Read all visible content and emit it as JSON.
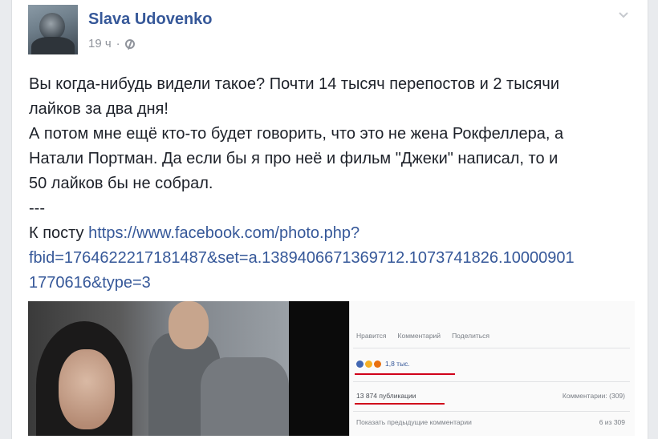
{
  "post": {
    "author": "Slava Udovenko",
    "time": "19 ч",
    "separator": "·",
    "text_lines": [
      "Вы когда-нибудь видели такое? Почти 14 тысяч перепостов и 2 тысячи",
      "лайков за два дня!",
      "А потом мне ещё кто-то будет говорить, что это не жена Рокфеллера, а",
      "Натали Портман. Да если бы я про неё и фильм \"Джеки\" написал, то и",
      "50 лайков бы не собрал.",
      "---"
    ],
    "link_prefix": "К посту ",
    "link_lines": [
      "https://www.facebook.com/photo.php?",
      "fbid=1764622217181487&set=a.1389406671369712.1073741826.10000901",
      "1770616&type=3"
    ]
  },
  "shared_screenshot": {
    "like_label": "Нравится",
    "comment_label": "Комментарий",
    "share_label": "Поделиться",
    "reactions_count": "1,8 тыс.",
    "shares_count": "13 874 публикации",
    "comments_count": "Комментарии: (309)",
    "prev_comments": "Показать предыдущие комментарии",
    "page_count": "6 из 309"
  },
  "colors": {
    "link": "#365899",
    "text": "#1d2129",
    "meta": "#90949c",
    "underline": "#d0021b"
  }
}
